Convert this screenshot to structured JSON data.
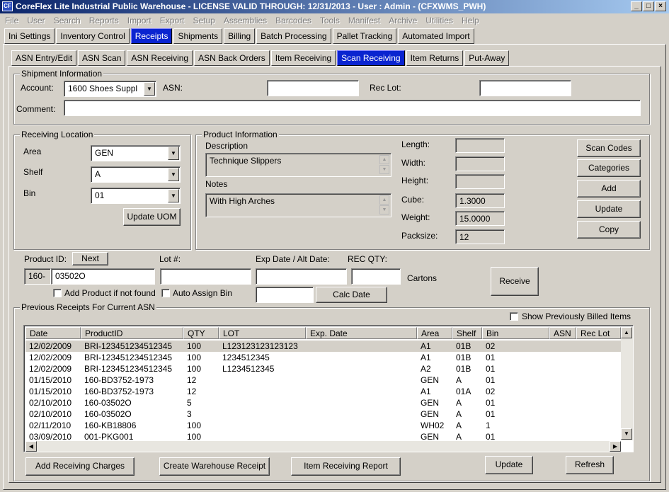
{
  "window": {
    "title": "CoreFlex Lite Industrial Public Warehouse - LICENSE VALID THROUGH: 12/31/2013 - User : Admin - (CFXWMS_PWH)"
  },
  "menu": [
    "File",
    "User",
    "Search",
    "Reports",
    "Import",
    "Export",
    "Setup",
    "Assemblies",
    "Barcodes",
    "Tools",
    "Manifest",
    "Archive",
    "Utilities",
    "Help"
  ],
  "main_tabs": [
    "Ini Settings",
    "Inventory Control",
    "Receipts",
    "Shipments",
    "Billing",
    "Batch Processing",
    "Pallet Tracking",
    "Automated Import"
  ],
  "main_tab_active": 2,
  "sub_tabs": [
    "ASN Entry/Edit",
    "ASN Scan",
    "ASN Receiving",
    "ASN Back Orders",
    "Item Receiving",
    "Scan Receiving",
    "Item Returns",
    "Put-Away"
  ],
  "sub_tab_active": 5,
  "shipment": {
    "group_label": "Shipment Information",
    "account_label": "Account:",
    "account_value": "1600 Shoes Suppl",
    "asn_label": "ASN:",
    "asn_value": "",
    "reclot_label": "Rec Lot:",
    "reclot_value": "",
    "comment_label": "Comment:",
    "comment_value": ""
  },
  "location": {
    "group_label": "Receiving Location",
    "area_label": "Area",
    "area_value": "GEN",
    "shelf_label": "Shelf",
    "shelf_value": "A",
    "bin_label": "Bin",
    "bin_value": "01",
    "update_uom": "Update UOM"
  },
  "product": {
    "group_label": "Product Information",
    "description_label": "Description",
    "description_value": "Technique Slippers",
    "notes_label": "Notes",
    "notes_value": "With High Arches",
    "length_label": "Length:",
    "length_value": "",
    "width_label": "Width:",
    "width_value": "",
    "height_label": "Height:",
    "height_value": "",
    "cube_label": "Cube:",
    "cube_value": "1.3000",
    "weight_label": "Weight:",
    "weight_value": "15.0000",
    "packsize_label": "Packsize:",
    "packsize_value": "12",
    "buttons": [
      "Scan Codes",
      "Categories",
      "Add",
      "Update",
      "Copy"
    ]
  },
  "entry": {
    "product_id_label": "Product ID:",
    "next": "Next",
    "prefix": "160-",
    "product_id_value": "03502O",
    "lot_label": "Lot #:",
    "lot_value": "",
    "exp_label": "Exp Date / Alt Date:",
    "exp_value": "",
    "alt_value": "",
    "qty_label": "REC QTY:",
    "qty_value": "",
    "cartons": "Cartons",
    "add_product": "Add Product if not found",
    "auto_assign": "Auto Assign Bin",
    "calc_date": "Calc Date",
    "receive": "Receive"
  },
  "receipts": {
    "group_label": "Previous Receipts For Current ASN",
    "show_billed": "Show Previously Billed Items",
    "columns": [
      "Date",
      "ProductID",
      "QTY",
      "LOT",
      "Exp. Date",
      "Area",
      "Shelf",
      "Bin",
      "ASN",
      "Rec Lot"
    ],
    "rows": [
      [
        "12/02/2009",
        "BRI-123451234512345",
        "100",
        "L123123123123123",
        "",
        "A1",
        "01B",
        "02",
        "",
        ""
      ],
      [
        "12/02/2009",
        "BRI-123451234512345",
        "100",
        "1234512345",
        "",
        "A1",
        "01B",
        "01",
        "",
        ""
      ],
      [
        "12/02/2009",
        "BRI-123451234512345",
        "100",
        "L1234512345",
        "",
        "A2",
        "01B",
        "01",
        "",
        ""
      ],
      [
        "01/15/2010",
        "160-BD3752-1973",
        "12",
        "",
        "",
        "GEN",
        "A",
        "01",
        "",
        ""
      ],
      [
        "01/15/2010",
        "160-BD3752-1973",
        "12",
        "",
        "",
        "A1",
        "01A",
        "02",
        "",
        ""
      ],
      [
        "02/10/2010",
        "160-03502O",
        "5",
        "",
        "",
        "GEN",
        "A",
        "01",
        "",
        ""
      ],
      [
        "02/10/2010",
        "160-03502O",
        "3",
        "",
        "",
        "GEN",
        "A",
        "01",
        "",
        ""
      ],
      [
        "02/11/2010",
        "160-KB18806",
        "100",
        "",
        "",
        "WH02",
        "A",
        "1",
        "",
        ""
      ],
      [
        "03/09/2010",
        "001-PKG001",
        "100",
        "",
        "",
        "GEN",
        "A",
        "01",
        "",
        ""
      ]
    ]
  },
  "bottom": {
    "add_charges": "Add Receiving Charges",
    "create_receipt": "Create Warehouse Receipt",
    "item_report": "Item Receiving Report",
    "update": "Update",
    "refresh": "Refresh"
  }
}
